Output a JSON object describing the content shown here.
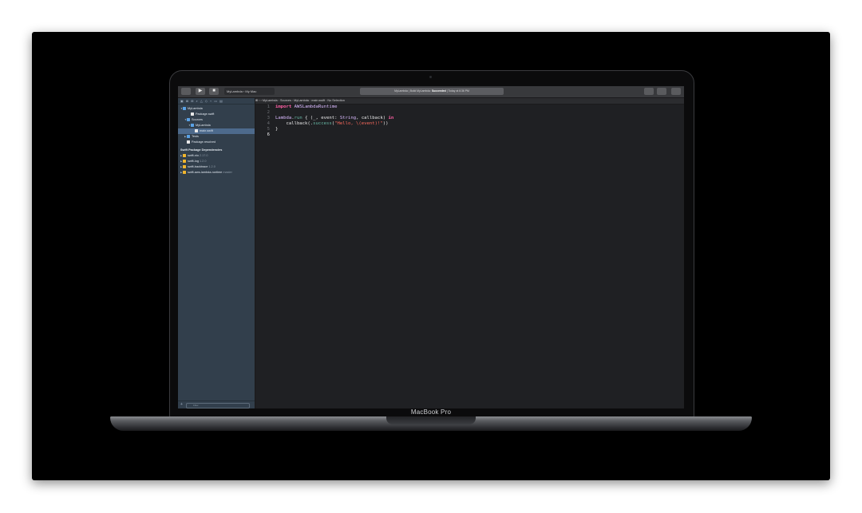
{
  "device": {
    "label": "MacBook Pro"
  },
  "toolbar": {
    "scheme_target": "MyLambda",
    "scheme_device": "My Mac",
    "status_prefix": "MyLambda | Build MyLambda: ",
    "status_result": "Succeeded",
    "status_suffix": " | Today at 6:36 PM"
  },
  "navigator": {
    "tree": [
      {
        "label": "MyLambda",
        "icon": "folder",
        "indent": 0,
        "expanded": true
      },
      {
        "label": "Package.swift",
        "icon": "file",
        "indent": 2
      },
      {
        "label": "Sources",
        "icon": "folder",
        "indent": 1,
        "expanded": true
      },
      {
        "label": "MyLambda",
        "icon": "folder",
        "indent": 2,
        "expanded": true
      },
      {
        "label": "main.swift",
        "icon": "file",
        "indent": 3,
        "selected": true
      },
      {
        "label": "Tests",
        "icon": "folder",
        "indent": 1,
        "expanded": false
      },
      {
        "label": "Package.resolved",
        "icon": "file",
        "indent": 1
      }
    ],
    "deps_title": "Swift Package Dependencies",
    "deps": [
      {
        "name": "swift-nio",
        "version": "2.17.0"
      },
      {
        "name": "swift-log",
        "version": "1.2.0"
      },
      {
        "name": "swift-backtrace",
        "version": "1.2.0"
      },
      {
        "name": "swift-aws-lambda-runtime",
        "version": "master"
      }
    ],
    "filter_placeholder": "Filter"
  },
  "jumpbar": {
    "crumbs": [
      "MyLambda",
      "Sources",
      "MyLambda",
      "main.swift",
      "No Selection"
    ]
  },
  "editor": {
    "lines": [
      {
        "n": "1",
        "code": "import AWSLambdaRuntime"
      },
      {
        "n": "2",
        "code": ""
      },
      {
        "n": "3",
        "code": "Lambda.run { (_, event: String, callback) in"
      },
      {
        "n": "4",
        "code": "    callback(.success(\"Hello, \\(event)!\"))"
      },
      {
        "n": "5",
        "code": "}"
      },
      {
        "n": "6",
        "code": ""
      }
    ]
  },
  "colors": {
    "keyword": "#fc5fa3",
    "string": "#fc6a5d",
    "type": "#dabaff",
    "navigator_bg": "#323f4c",
    "editor_bg": "#1f2023"
  }
}
